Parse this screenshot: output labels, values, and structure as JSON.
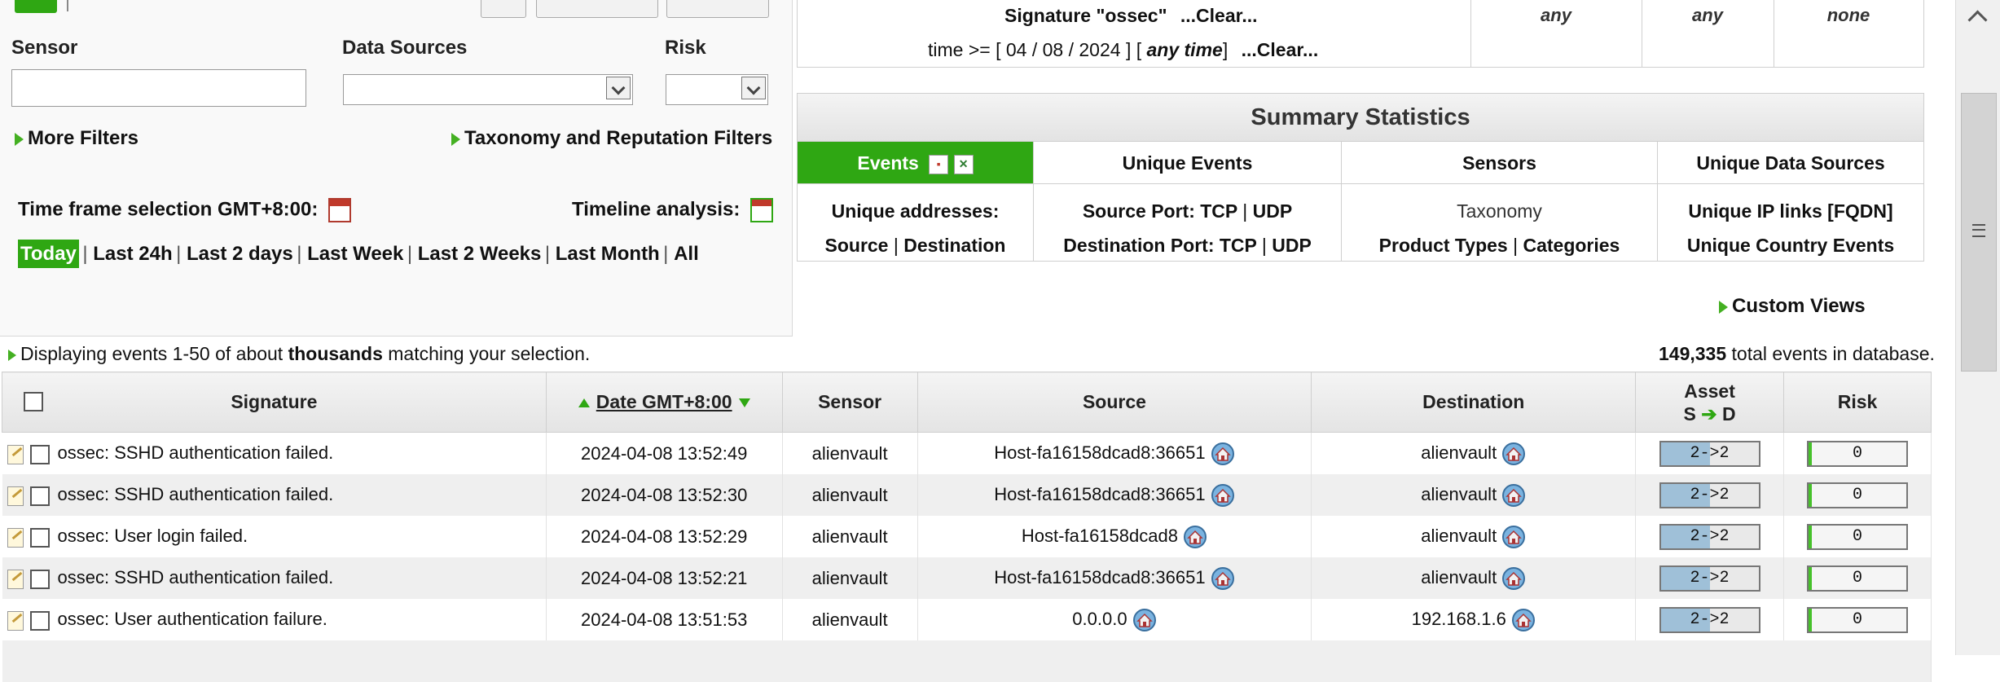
{
  "filters": {
    "sensor_label": "Sensor",
    "sensor_value": "",
    "data_sources_label": "Data Sources",
    "data_sources_value": "",
    "risk_label": "Risk",
    "risk_value": "",
    "more_filters": "More Filters",
    "taxonomy_filters": "Taxonomy and Reputation Filters",
    "time_frame_label": "Time frame selection GMT+8:00:",
    "timeline_label": "Timeline analysis:",
    "time_ranges": [
      "Today",
      "Last 24h",
      "Last 2 days",
      "Last Week",
      "Last 2 Weeks",
      "Last Month",
      "All"
    ],
    "active_range": "Today"
  },
  "criteria": {
    "signature_line": "Signature \"ossec\"",
    "signature_clear": "...Clear...",
    "time_prefix": "time >= [ 04 / 08 / 2024 ] [",
    "time_italic": "any time",
    "time_suffix": "]",
    "time_clear": "...Clear...",
    "cols": [
      "any",
      "any",
      "none"
    ]
  },
  "summary": {
    "title": "Summary Statistics",
    "events_tab": "Events",
    "unique_events": "Unique Events",
    "sensors": "Sensors",
    "unique_data_sources": "Unique Data Sources",
    "unique_addresses": "Unique addresses:",
    "source": "Source",
    "destination": "Destination",
    "source_port": "Source Port: TCP",
    "source_port_udp": "UDP",
    "destination_port": "Destination Port: TCP",
    "destination_port_udp": "UDP",
    "taxonomy": "Taxonomy",
    "product_types": "Product Types",
    "categories": "Categories",
    "unique_ip_links": "Unique IP links [FQDN]",
    "unique_country_events": "Unique Country Events",
    "custom_views": "Custom Views"
  },
  "display": {
    "prefix": "Displaying events 1-50 of about",
    "bold": "thousands",
    "suffix": "matching your selection.",
    "total_bold": "149,335",
    "total_suffix": "total events in database."
  },
  "table": {
    "headers": {
      "signature": "Signature",
      "date": "Date GMT+8:00",
      "sensor": "Sensor",
      "source": "Source",
      "destination": "Destination",
      "asset_line1": "Asset",
      "asset_line2": "S",
      "asset_line3": "D",
      "risk": "Risk"
    },
    "rows": [
      {
        "signature": "ossec: SSHD authentication failed.",
        "date": "2024-04-08 13:52:49",
        "sensor": "alienvault",
        "source": "Host-fa16158dcad8:36651",
        "destination": "alienvault",
        "asset": "2->2",
        "risk": "0"
      },
      {
        "signature": "ossec: SSHD authentication failed.",
        "date": "2024-04-08 13:52:30",
        "sensor": "alienvault",
        "source": "Host-fa16158dcad8:36651",
        "destination": "alienvault",
        "asset": "2->2",
        "risk": "0"
      },
      {
        "signature": "ossec: User login failed.",
        "date": "2024-04-08 13:52:29",
        "sensor": "alienvault",
        "source": "Host-fa16158dcad8",
        "destination": "alienvault",
        "asset": "2->2",
        "risk": "0"
      },
      {
        "signature": "ossec: SSHD authentication failed.",
        "date": "2024-04-08 13:52:21",
        "sensor": "alienvault",
        "source": "Host-fa16158dcad8:36651",
        "destination": "alienvault",
        "asset": "2->2",
        "risk": "0"
      },
      {
        "signature": "ossec: User authentication failure.",
        "date": "2024-04-08 13:51:53",
        "sensor": "alienvault",
        "source": "0.0.0.0",
        "destination": "192.168.1.6",
        "asset": "2->2",
        "risk": "0"
      }
    ]
  },
  "colors": {
    "accent_green": "#2fa713",
    "asset_blue": "#9fc0d8"
  }
}
